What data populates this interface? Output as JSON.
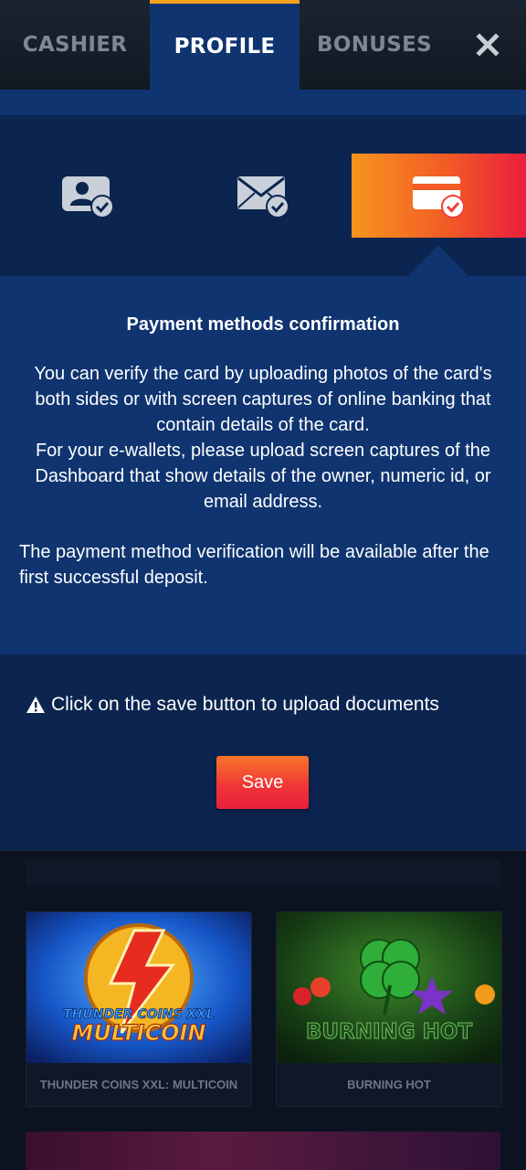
{
  "tabs": {
    "cashier": "CASHIER",
    "profile": "PROFILE",
    "bonuses": "BONUSES"
  },
  "icons": {
    "close": "close-icon",
    "step1": "id-card-check-icon",
    "step2": "envelope-check-icon",
    "step3": "credit-card-check-icon",
    "warning": "warning-icon"
  },
  "colors": {
    "active_tab_border": "#f6a21c",
    "panel_blue": "#0f3470",
    "accent_gradient_start": "#f7941d",
    "accent_gradient_end": "#e91e3c"
  },
  "info": {
    "title": "Payment methods confirmation",
    "description": "You can verify the card by uploading photos of the card's both sides or with screen captures of online banking that contain details of the card.\nFor your e-wallets, please upload screen captures of the Dashboard that show details of the owner, numeric id, or email address.",
    "note": "The payment method verification will be available after the first successful deposit."
  },
  "upload": {
    "warning_text": "Click on the save button to upload documents",
    "save_label": "Save"
  },
  "games": [
    {
      "name": "THUNDER COINS XXL: MULTICOIN",
      "logo_line1": "THUNDER COINS XXL",
      "logo_line2": "MULTICOIN"
    },
    {
      "name": "BURNING HOT",
      "logo_line1": "BURNING HOT"
    }
  ]
}
